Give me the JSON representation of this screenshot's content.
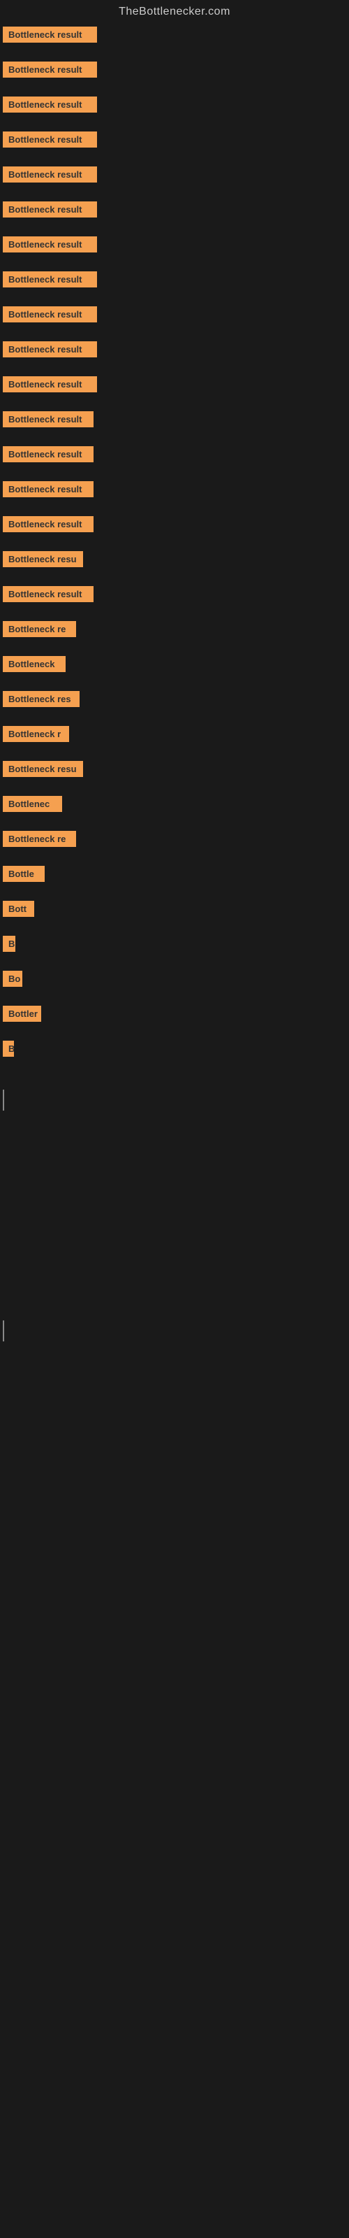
{
  "site_title": "TheBottlenecker.com",
  "bars": [
    {
      "label": "Bottleneck result",
      "width": 135
    },
    {
      "label": "Bottleneck result",
      "width": 135
    },
    {
      "label": "Bottleneck result",
      "width": 135
    },
    {
      "label": "Bottleneck result",
      "width": 135
    },
    {
      "label": "Bottleneck result",
      "width": 135
    },
    {
      "label": "Bottleneck result",
      "width": 135
    },
    {
      "label": "Bottleneck result",
      "width": 135
    },
    {
      "label": "Bottleneck result",
      "width": 135
    },
    {
      "label": "Bottleneck result",
      "width": 135
    },
    {
      "label": "Bottleneck result",
      "width": 135
    },
    {
      "label": "Bottleneck result",
      "width": 135
    },
    {
      "label": "Bottleneck result",
      "width": 130
    },
    {
      "label": "Bottleneck result",
      "width": 130
    },
    {
      "label": "Bottleneck result",
      "width": 130
    },
    {
      "label": "Bottleneck result",
      "width": 130
    },
    {
      "label": "Bottleneck resu",
      "width": 115
    },
    {
      "label": "Bottleneck result",
      "width": 130
    },
    {
      "label": "Bottleneck re",
      "width": 105
    },
    {
      "label": "Bottleneck",
      "width": 90
    },
    {
      "label": "Bottleneck res",
      "width": 110
    },
    {
      "label": "Bottleneck r",
      "width": 95
    },
    {
      "label": "Bottleneck resu",
      "width": 115
    },
    {
      "label": "Bottlenec",
      "width": 85
    },
    {
      "label": "Bottleneck re",
      "width": 105
    },
    {
      "label": "Bottle",
      "width": 60
    },
    {
      "label": "Bott",
      "width": 45
    },
    {
      "label": "B",
      "width": 18
    },
    {
      "label": "Bo",
      "width": 28
    },
    {
      "label": "Bottler",
      "width": 55
    },
    {
      "label": "B",
      "width": 15
    }
  ]
}
